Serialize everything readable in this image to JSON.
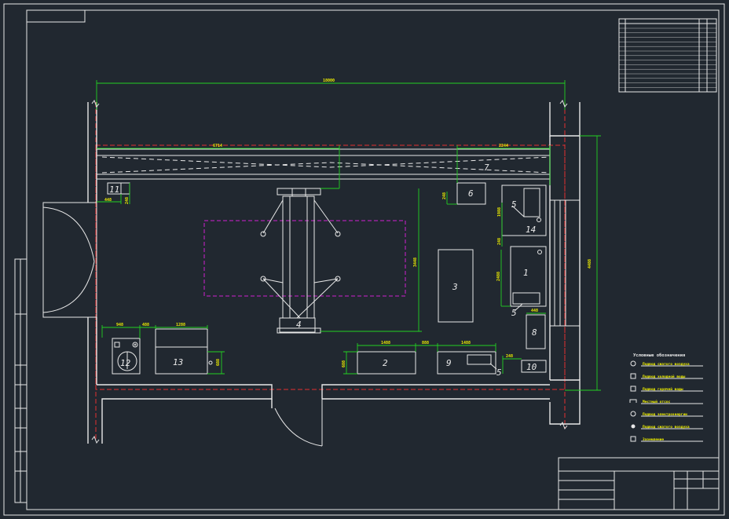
{
  "dimensions": {
    "overall_length": "18000",
    "crane_span": "6714",
    "right_block": "2244",
    "height_right": "4488",
    "post_height": "3448",
    "w11": "448",
    "h11": "248",
    "h6": "248",
    "h14": "1988",
    "gap14": "248",
    "gap1": "248",
    "h1": "2488",
    "w12": "948",
    "gap12": "488",
    "w13": "1288",
    "h13": "688",
    "w2": "1488",
    "gap29": "888",
    "w9": "1488",
    "h2": "688",
    "w8": "448",
    "gap10": "248"
  },
  "equipment": {
    "n1": "1",
    "n2": "2",
    "n3": "3",
    "n4": "4",
    "n5": "5",
    "n6": "6",
    "n7": "7",
    "n8": "8",
    "n9": "9",
    "n10": "10",
    "n11": "11",
    "n12": "12",
    "n13": "13",
    "n14": "14"
  },
  "legend": {
    "title": "Условные обозначения",
    "items": [
      "Подвод сжатого воздуха",
      "Подвод холодной воды",
      "Подвод горячей воды",
      "Местный отсос",
      "Подвод электроэнергии",
      "Подвод сжатого воздуха",
      "Заземление"
    ]
  },
  "colors": {
    "background": "#212830",
    "line": "#e8e8e8",
    "dimension": "#22d022",
    "axis": "#e23030",
    "work_zone": "#d020d0",
    "text": "#f0f000"
  }
}
